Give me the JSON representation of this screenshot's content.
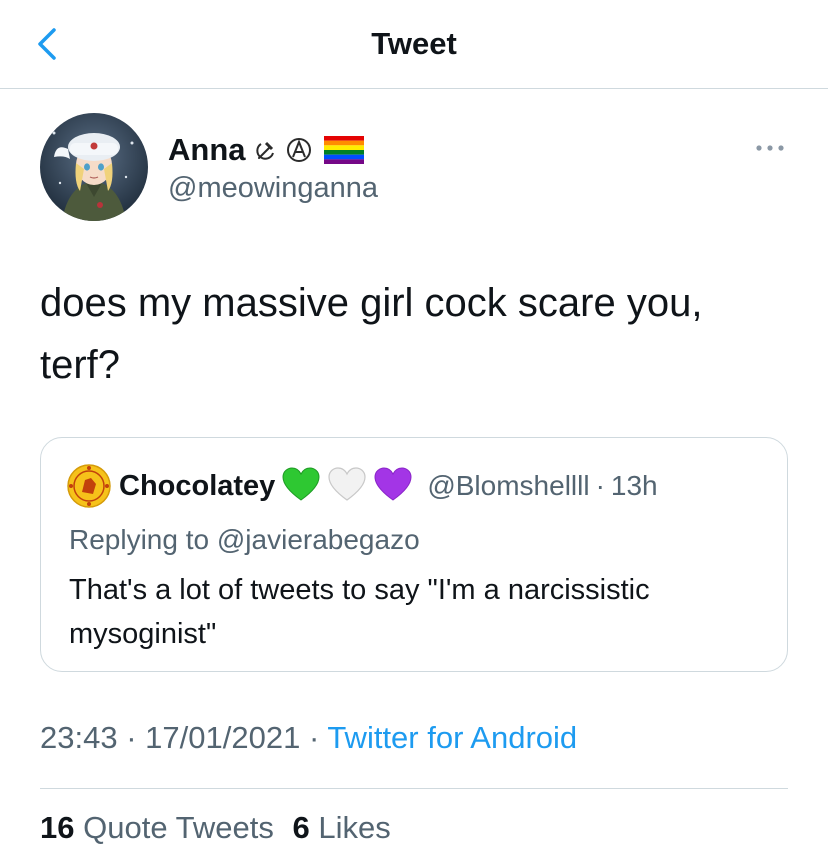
{
  "nav": {
    "title": "Tweet"
  },
  "author": {
    "name": "Anna",
    "handle": "@meowinganna",
    "badges": [
      "hammer-sickle-icon",
      "anarchy-icon",
      "rainbow-flag-icon"
    ]
  },
  "tweet": {
    "text": "does my massive girl cock scare you, terf?"
  },
  "quote": {
    "name": "Chocolatey",
    "handle": "@Blomshellll",
    "sep": "·",
    "time": "13h",
    "hearts": [
      "green-heart-icon",
      "white-heart-icon",
      "purple-heart-icon"
    ],
    "replying_prefix": "Replying to",
    "replying_to": "@javierabegazo",
    "text": "That's a lot of tweets to say \"I'm a narcissistic mysoginist\""
  },
  "meta": {
    "time": "23:43",
    "sep": "·",
    "date": "17/01/2021",
    "source": "Twitter for Android"
  },
  "stats": {
    "quote_count": "16",
    "quote_label": "Quote Tweets",
    "like_count": "6",
    "like_label": "Likes"
  },
  "colors": {
    "accent": "#1d9bf0",
    "secondary_text": "#536471",
    "border": "#cfd9de"
  }
}
